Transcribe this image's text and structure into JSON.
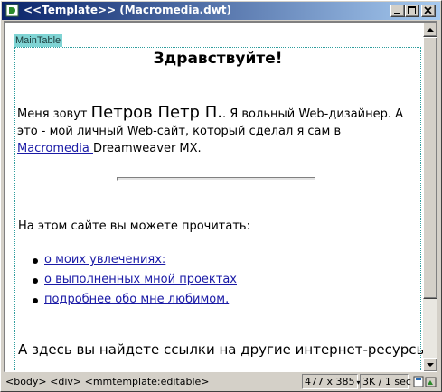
{
  "window": {
    "title": "<<Template>> (Macromedia.dwt)"
  },
  "document": {
    "region_label": "MainTable",
    "heading": "Здравствуйте!",
    "intro": {
      "prefix": "Меня зовут ",
      "name": "Петров Петр П.",
      "middle": ". Я вольный Web-дизайнер. А это - мой личный Web-сайт, который сделал я сам в ",
      "link_text": "Macromedia ",
      "suffix": "Dreamweaver MX."
    },
    "read_label": "На этом сайте вы можете прочитать:",
    "links": [
      "о моих увлечениях:",
      "о выполненных мной проектах",
      "подробнее обо мне любимом."
    ],
    "footer": "А здесь вы найдете ссылки на другие интернет-ресурсы."
  },
  "statusbar": {
    "tag_selector": "<body> <div> <mmtemplate:editable>",
    "window_size": "477 x 385",
    "download": "3K / 1 sec"
  },
  "colors": {
    "title_bar_start": "#0a246a",
    "title_bar_end": "#a6caf0",
    "link": "#1a1aa6",
    "region_label_bg": "#7fd4d4"
  }
}
